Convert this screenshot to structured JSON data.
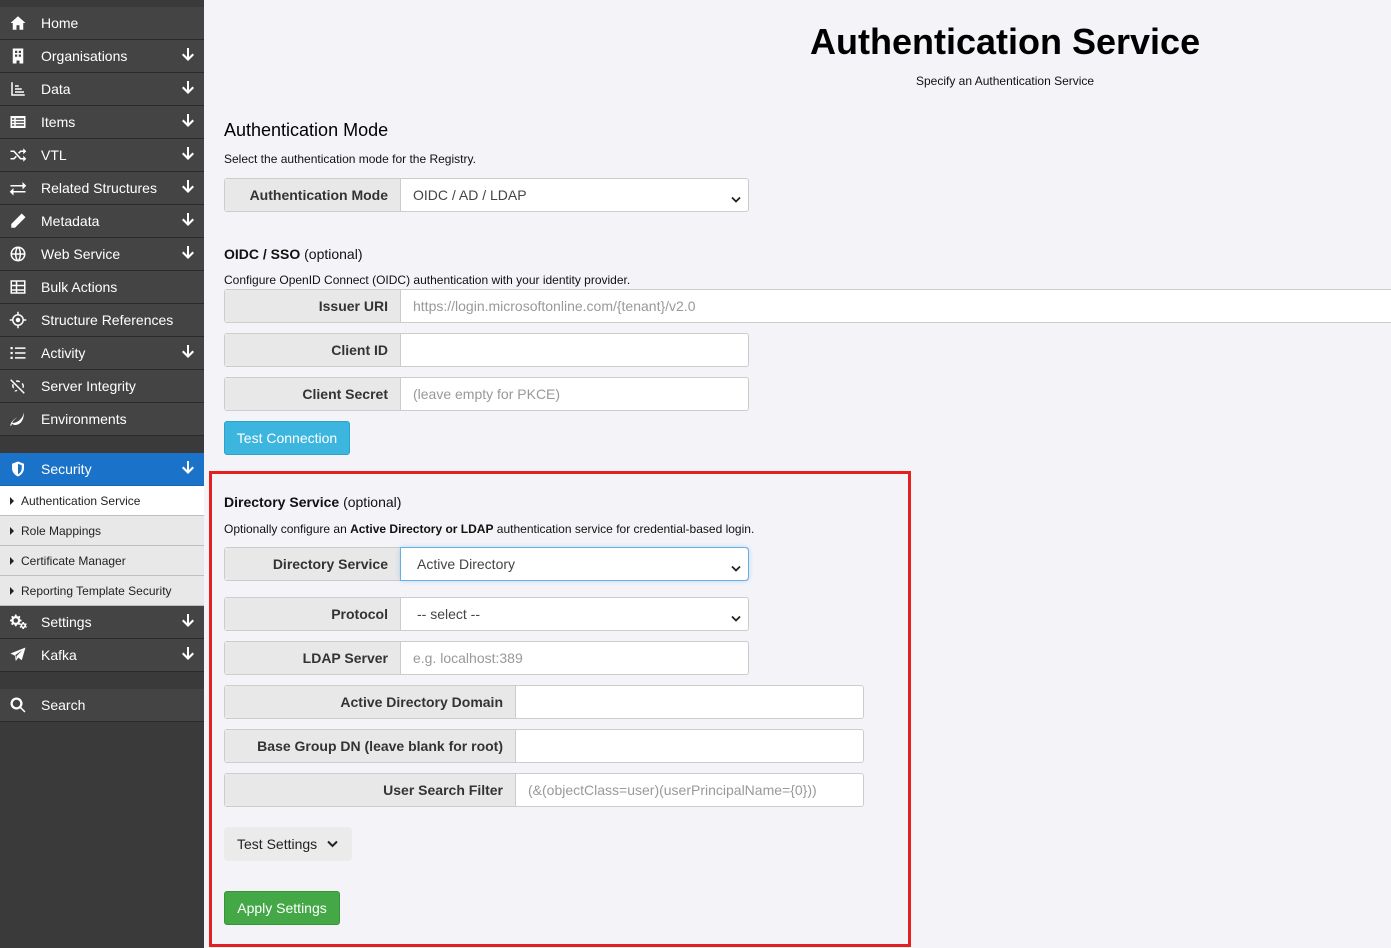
{
  "sidebar": {
    "items": [
      {
        "label": "Home",
        "icon": "home-icon",
        "arrow": false
      },
      {
        "label": "Organisations",
        "icon": "building-icon",
        "arrow": true
      },
      {
        "label": "Data",
        "icon": "chart-icon",
        "arrow": true
      },
      {
        "label": "Items",
        "icon": "list-icon",
        "arrow": true
      },
      {
        "label": "VTL",
        "icon": "shuffle-icon",
        "arrow": true
      },
      {
        "label": "Related Structures",
        "icon": "exchange-icon",
        "arrow": true
      },
      {
        "label": "Metadata",
        "icon": "pencil-icon",
        "arrow": true
      },
      {
        "label": "Web Service",
        "icon": "globe-icon",
        "arrow": true
      },
      {
        "label": "Bulk Actions",
        "icon": "table-icon",
        "arrow": false
      },
      {
        "label": "Structure References",
        "icon": "crosshair-icon",
        "arrow": false
      },
      {
        "label": "Activity",
        "icon": "bullet-list-icon",
        "arrow": true
      },
      {
        "label": "Server Integrity",
        "icon": "broken-link-icon",
        "arrow": false
      },
      {
        "label": "Environments",
        "icon": "leaf-icon",
        "arrow": false
      }
    ],
    "security": {
      "label": "Security",
      "icon": "shield-icon"
    },
    "security_sub": [
      "Authentication Service",
      "Role Mappings",
      "Certificate Manager",
      "Reporting Template Security"
    ],
    "lower_items": [
      {
        "label": "Settings",
        "icon": "gears-icon",
        "arrow": true
      },
      {
        "label": "Kafka",
        "icon": "paper-plane-icon",
        "arrow": true
      }
    ],
    "search": {
      "label": "Search",
      "icon": "search-icon"
    }
  },
  "page": {
    "title": "Authentication Service",
    "subtitle": "Specify an Authentication Service"
  },
  "auth_mode": {
    "heading": "Authentication Mode",
    "description": "Select the authentication mode for the Registry.",
    "label": "Authentication Mode",
    "value": "OIDC / AD / LDAP"
  },
  "oidc": {
    "heading_bold": "OIDC / SSO",
    "heading_rest": " (optional)",
    "description": "Configure OpenID Connect (OIDC) authentication with your identity provider.",
    "issuer_label": "Issuer URI",
    "issuer_placeholder": "https://login.microsoftonline.com/{tenant}/v2.0",
    "client_id_label": "Client ID",
    "client_id_value": "",
    "client_secret_label": "Client Secret",
    "client_secret_placeholder": "(leave empty for PKCE)",
    "test_button": "Test Connection"
  },
  "directory": {
    "heading_bold": "Directory Service",
    "heading_rest": " (optional)",
    "desc_pre": "Optionally configure an ",
    "desc_bold": "Active Directory or LDAP",
    "desc_post": " authentication service for credential-based login.",
    "service_label": "Directory Service",
    "service_value": "Active Directory",
    "protocol_label": "Protocol",
    "protocol_value": "-- select --",
    "ldap_label": "LDAP Server",
    "ldap_placeholder": "e.g. localhost:389",
    "ad_domain_label": "Active Directory Domain",
    "ad_domain_value": "",
    "base_dn_label": "Base Group DN (leave blank for root)",
    "base_dn_value": "",
    "filter_label": "User Search Filter",
    "filter_placeholder": "(&(objectClass=user)(userPrincipalName={0}))",
    "test_settings": "Test Settings",
    "apply_button": "Apply Settings"
  },
  "colors": {
    "sidebar_bg": "#444444",
    "active_bg": "#1b73c9",
    "info": "#3cb6de",
    "success": "#43a845",
    "highlight": "#e3201f"
  }
}
